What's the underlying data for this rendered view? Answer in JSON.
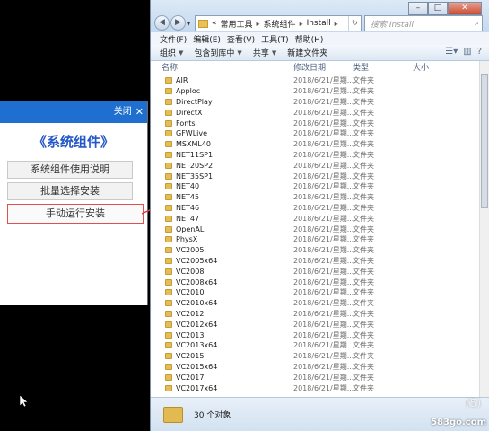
{
  "tool": {
    "close_label": "关闭",
    "close_glyph": "✕",
    "title": "《系统组件》",
    "buttons": [
      "系统组件使用说明",
      "批量选择安装",
      "手动运行安装"
    ]
  },
  "explorer": {
    "window_controls": [
      "–",
      "□",
      "✕"
    ],
    "breadcrumb": [
      "«",
      "常用工具",
      "系统组件",
      "Install"
    ],
    "search_placeholder": "搜索 Install",
    "menus": [
      "文件(F)",
      "编辑(E)",
      "查看(V)",
      "工具(T)",
      "帮助(H)"
    ],
    "toolbar": [
      "组织",
      "包含到库中",
      "共享",
      "新建文件夹"
    ],
    "columns": [
      "名称",
      "修改日期",
      "类型",
      "大小"
    ],
    "files": [
      {
        "name": "AIR",
        "date": "2018/6/21/星期...",
        "type": "文件夹"
      },
      {
        "name": "Apploc",
        "date": "2018/6/21/星期...",
        "type": "文件夹"
      },
      {
        "name": "DirectPlay",
        "date": "2018/6/21/星期...",
        "type": "文件夹"
      },
      {
        "name": "DirectX",
        "date": "2018/6/21/星期...",
        "type": "文件夹"
      },
      {
        "name": "Fonts",
        "date": "2018/6/21/星期...",
        "type": "文件夹"
      },
      {
        "name": "GFWLive",
        "date": "2018/6/21/星期...",
        "type": "文件夹"
      },
      {
        "name": "MSXML40",
        "date": "2018/6/21/星期...",
        "type": "文件夹"
      },
      {
        "name": "NET11SP1",
        "date": "2018/6/21/星期...",
        "type": "文件夹"
      },
      {
        "name": "NET20SP2",
        "date": "2018/6/21/星期...",
        "type": "文件夹"
      },
      {
        "name": "NET35SP1",
        "date": "2018/6/21/星期...",
        "type": "文件夹"
      },
      {
        "name": "NET40",
        "date": "2018/6/21/星期...",
        "type": "文件夹"
      },
      {
        "name": "NET45",
        "date": "2018/6/21/星期...",
        "type": "文件夹"
      },
      {
        "name": "NET46",
        "date": "2018/6/21/星期...",
        "type": "文件夹"
      },
      {
        "name": "NET47",
        "date": "2018/6/21/星期...",
        "type": "文件夹"
      },
      {
        "name": "OpenAL",
        "date": "2018/6/21/星期...",
        "type": "文件夹"
      },
      {
        "name": "PhysX",
        "date": "2018/6/21/星期...",
        "type": "文件夹"
      },
      {
        "name": "VC2005",
        "date": "2018/6/21/星期...",
        "type": "文件夹"
      },
      {
        "name": "VC2005x64",
        "date": "2018/6/21/星期...",
        "type": "文件夹"
      },
      {
        "name": "VC2008",
        "date": "2018/6/21/星期...",
        "type": "文件夹"
      },
      {
        "name": "VC2008x64",
        "date": "2018/6/21/星期...",
        "type": "文件夹"
      },
      {
        "name": "VC2010",
        "date": "2018/6/21/星期...",
        "type": "文件夹"
      },
      {
        "name": "VC2010x64",
        "date": "2018/6/21/星期...",
        "type": "文件夹"
      },
      {
        "name": "VC2012",
        "date": "2018/6/21/星期...",
        "type": "文件夹"
      },
      {
        "name": "VC2012x64",
        "date": "2018/6/21/星期...",
        "type": "文件夹"
      },
      {
        "name": "VC2013",
        "date": "2018/6/21/星期...",
        "type": "文件夹"
      },
      {
        "name": "VC2013x64",
        "date": "2018/6/21/星期...",
        "type": "文件夹"
      },
      {
        "name": "VC2015",
        "date": "2018/6/21/星期...",
        "type": "文件夹"
      },
      {
        "name": "VC2015x64",
        "date": "2018/6/21/星期...",
        "type": "文件夹"
      },
      {
        "name": "VC2017",
        "date": "2018/6/21/星期...",
        "type": "文件夹"
      },
      {
        "name": "VC2017x64",
        "date": "2018/6/21/星期...",
        "type": "文件夹"
      }
    ],
    "status_text": "30 个对象"
  },
  "watermark": "583go.com",
  "watermark_faint": "(5)"
}
